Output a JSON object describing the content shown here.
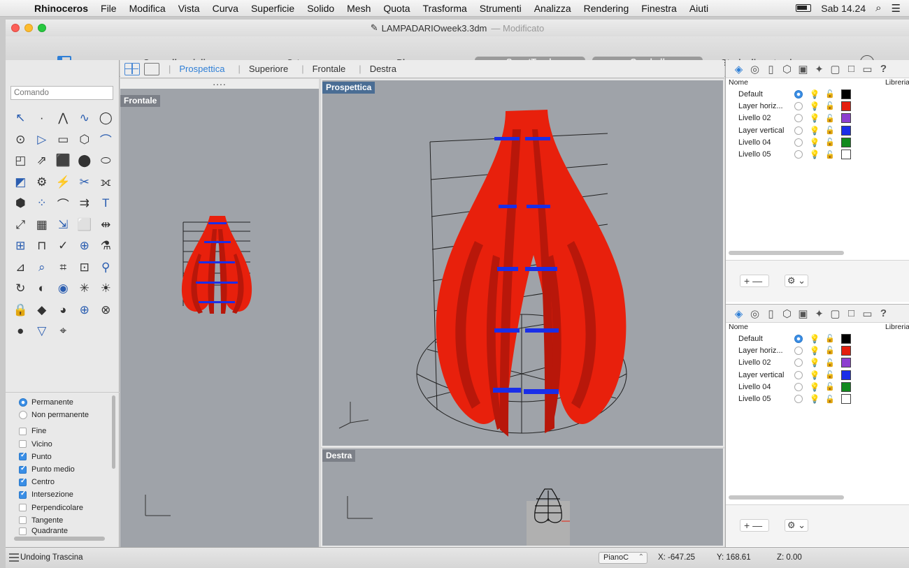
{
  "menubar": {
    "app": "Rhinoceros",
    "items": [
      "File",
      "Modifica",
      "Vista",
      "Curva",
      "Superficie",
      "Solido",
      "Mesh",
      "Quota",
      "Trasforma",
      "Strumenti",
      "Analizza",
      "Rendering",
      "Finestra",
      "Aiuti"
    ],
    "clock": "Sab 14.24"
  },
  "window": {
    "filename": "LAMPADARIOweek3.3dm",
    "modified": "— Modificato"
  },
  "toolbar": {
    "grid_snap": "Snap alla griglia",
    "ortho": "Orto",
    "planar": "Planare",
    "smarttrack": "SmartTrack",
    "gumball": "Gumball",
    "history": "Storia di costruzione"
  },
  "command": {
    "placeholder": "Comando"
  },
  "tools": [
    "select-arrow",
    "point",
    "polyline",
    "curve-pts",
    "circle",
    "ellipse",
    "freeform",
    "rectangle",
    "polygon",
    "arc",
    "surface-edge",
    "extrude-surface",
    "box",
    "sphere",
    "cylinder",
    "mesh-face",
    "fillet",
    "explode",
    "trim",
    "split",
    "boolean",
    "group",
    "curve-fillet",
    "offset",
    "text-object",
    "transform",
    "array",
    "project",
    "box-edit",
    "dimension",
    "grid-points",
    "analysis",
    "check",
    "zoom-window",
    "paint",
    "light",
    "zoom-in",
    "zoom-all",
    "zoom-extents",
    "lightbulb",
    "rotate-view",
    "car",
    "camera",
    "explode-ctrl",
    "bulb",
    "lock",
    "paint-bucket",
    "color-wheel",
    "wire-sphere",
    "render-sphere",
    "render",
    "pointer",
    "pan"
  ],
  "osnap": {
    "modes": [
      {
        "label": "Permanente",
        "on": true
      },
      {
        "label": "Non permanente",
        "on": false
      }
    ],
    "items": [
      {
        "label": "Fine",
        "on": false
      },
      {
        "label": "Vicino",
        "on": false
      },
      {
        "label": "Punto",
        "on": true
      },
      {
        "label": "Punto medio",
        "on": true
      },
      {
        "label": "Centro",
        "on": true
      },
      {
        "label": "Intersezione",
        "on": true
      },
      {
        "label": "Perpendicolare",
        "on": false
      },
      {
        "label": "Tangente",
        "on": false
      },
      {
        "label": "Quadrante",
        "on": false
      }
    ]
  },
  "viewport_tabs": [
    "Prospettica",
    "Superiore",
    "Frontale",
    "Destra"
  ],
  "viewports": {
    "front": "Frontale",
    "perspective": "Prospettica",
    "right": "Destra"
  },
  "layers": {
    "col_name": "Nome",
    "col_library": "Libreria",
    "rows": [
      {
        "name": "Default",
        "color": "#000000",
        "current": true
      },
      {
        "name": "Layer horiz...",
        "color": "#e41e0e",
        "current": false
      },
      {
        "name": "Livello 02",
        "color": "#8d3fd0",
        "current": false
      },
      {
        "name": "Layer vertical",
        "color": "#1a2ee8",
        "current": false
      },
      {
        "name": "Livello 04",
        "color": "#128a1e",
        "current": false
      },
      {
        "name": "Livello 05",
        "color": "#ffffff",
        "current": false
      }
    ],
    "icons": [
      "layers-icon",
      "materials-icon",
      "document-icon",
      "object-icon",
      "camera-icon",
      "light-icon",
      "notes-icon",
      "display-icon",
      "monitor-icon",
      "help-icon"
    ]
  },
  "status": {
    "message": "Undoing Trascina",
    "cplane": "PianoC",
    "x": "X: -647.25",
    "y": "Y: 168.61",
    "z": "Z: 0.00"
  },
  "colors": {
    "accent": "#2f7fd6",
    "model_red": "#e8200c",
    "model_blue": "#1a2ee8",
    "viewport_bg": "#9fa3a9"
  }
}
